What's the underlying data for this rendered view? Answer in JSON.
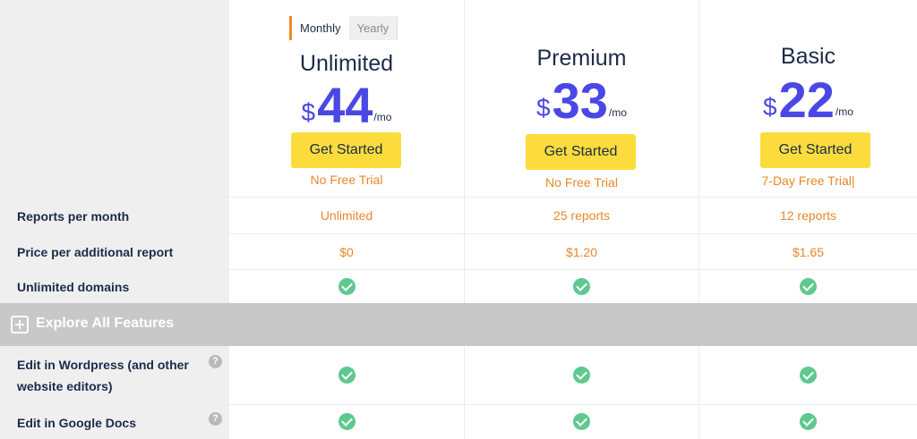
{
  "billing_toggle": {
    "monthly_label": "Monthly",
    "yearly_label": "Yearly"
  },
  "plans": [
    {
      "name": "Unlimited",
      "currency": "$",
      "price": "44",
      "period": "/mo",
      "cta": "Get Started",
      "trial": "No Free Trial"
    },
    {
      "name": "Premium",
      "currency": "$",
      "price": "33",
      "period": "/mo",
      "cta": "Get Started",
      "trial": "No Free Trial"
    },
    {
      "name": "Basic",
      "currency": "$",
      "price": "22",
      "period": "/mo",
      "cta": "Get Started",
      "trial": "7-Day Free Trial|"
    }
  ],
  "rows": [
    {
      "label": "Reports per month",
      "values": [
        "Unlimited",
        "25 reports",
        "12 reports"
      ]
    },
    {
      "label": "Price per additional report",
      "values": [
        "$0",
        "$1.20",
        "$1.65"
      ]
    },
    {
      "label": "Unlimited domains",
      "values": [
        "check",
        "check",
        "check"
      ]
    }
  ],
  "explore_features": {
    "label": "Explore All Features"
  },
  "feature_rows": [
    {
      "label": "Edit in Wordpress (and other website editors)",
      "help": "?",
      "values": [
        "check",
        "check",
        "check"
      ]
    },
    {
      "label": "Edit in Google Docs",
      "help": "?",
      "values": [
        "check",
        "check",
        "check"
      ]
    }
  ],
  "colors": {
    "accent_price": "#4b47e6",
    "button": "#fbdc3c",
    "orange_text": "#e8872a",
    "check": "#5ec98f",
    "label_bg": "#efefef"
  }
}
